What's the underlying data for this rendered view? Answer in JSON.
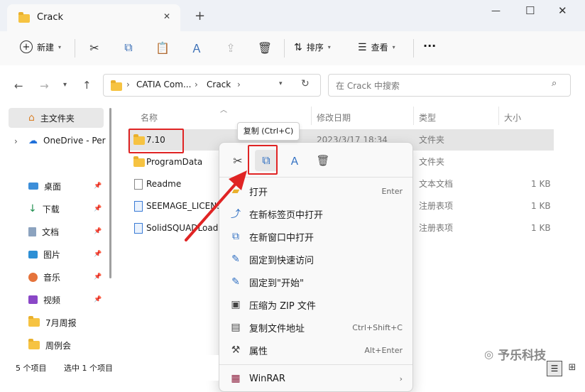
{
  "window": {
    "tab_title": "Crack",
    "new_tab": "+",
    "close_tab": "✕",
    "minimize": "—",
    "maximize": "☐",
    "close": "✕"
  },
  "toolbar": {
    "new_label": "新建",
    "sort_label": "排序",
    "view_label": "查看",
    "more": "···"
  },
  "address": {
    "crumbs": [
      "CATIA Com...",
      "Crack"
    ],
    "search_placeholder": "在 Crack 中搜索"
  },
  "nav": {
    "home": "主文件夹",
    "onedrive": "OneDrive - Per",
    "items": [
      "桌面",
      "下载",
      "文档",
      "图片",
      "音乐",
      "视频",
      "7月周报",
      "周例会"
    ]
  },
  "columns": {
    "name": "名称",
    "date": "修改日期",
    "type": "类型",
    "size": "大小"
  },
  "files": [
    {
      "name": "7.10",
      "date": "2023/3/17 18:34",
      "type": "文件夹",
      "size": ""
    },
    {
      "name": "ProgramData",
      "date": "",
      "type": "文件夹",
      "size": ""
    },
    {
      "name": "Readme",
      "date": "",
      "type": "文本文档",
      "size": "1 KB"
    },
    {
      "name": "SEEMAGE_LICENS",
      "date": "",
      "type": "注册表项",
      "size": "1 KB"
    },
    {
      "name": "SolidSQUADLoad",
      "date": "",
      "type": "注册表项",
      "size": "1 KB"
    }
  ],
  "tooltip": "复制 (Ctrl+C)",
  "menu": [
    {
      "label": "打开",
      "key": "Enter"
    },
    {
      "label": "在新标签页中打开",
      "key": ""
    },
    {
      "label": "在新窗口中打开",
      "key": ""
    },
    {
      "label": "固定到快速访问",
      "key": ""
    },
    {
      "label": "固定到\"开始\"",
      "key": ""
    },
    {
      "label": "压缩为 ZIP 文件",
      "key": ""
    },
    {
      "label": "复制文件地址",
      "key": "Ctrl+Shift+C"
    },
    {
      "label": "属性",
      "key": "Alt+Enter"
    },
    {
      "label": "WinRAR",
      "key": "›"
    }
  ],
  "status": {
    "count": "5 个项目",
    "selected": "选中 1 个项目"
  },
  "watermark": "予乐科技",
  "colors": {
    "accent": "#2f6fc2",
    "highlight": "#e02424",
    "folder": "#f6c342"
  }
}
